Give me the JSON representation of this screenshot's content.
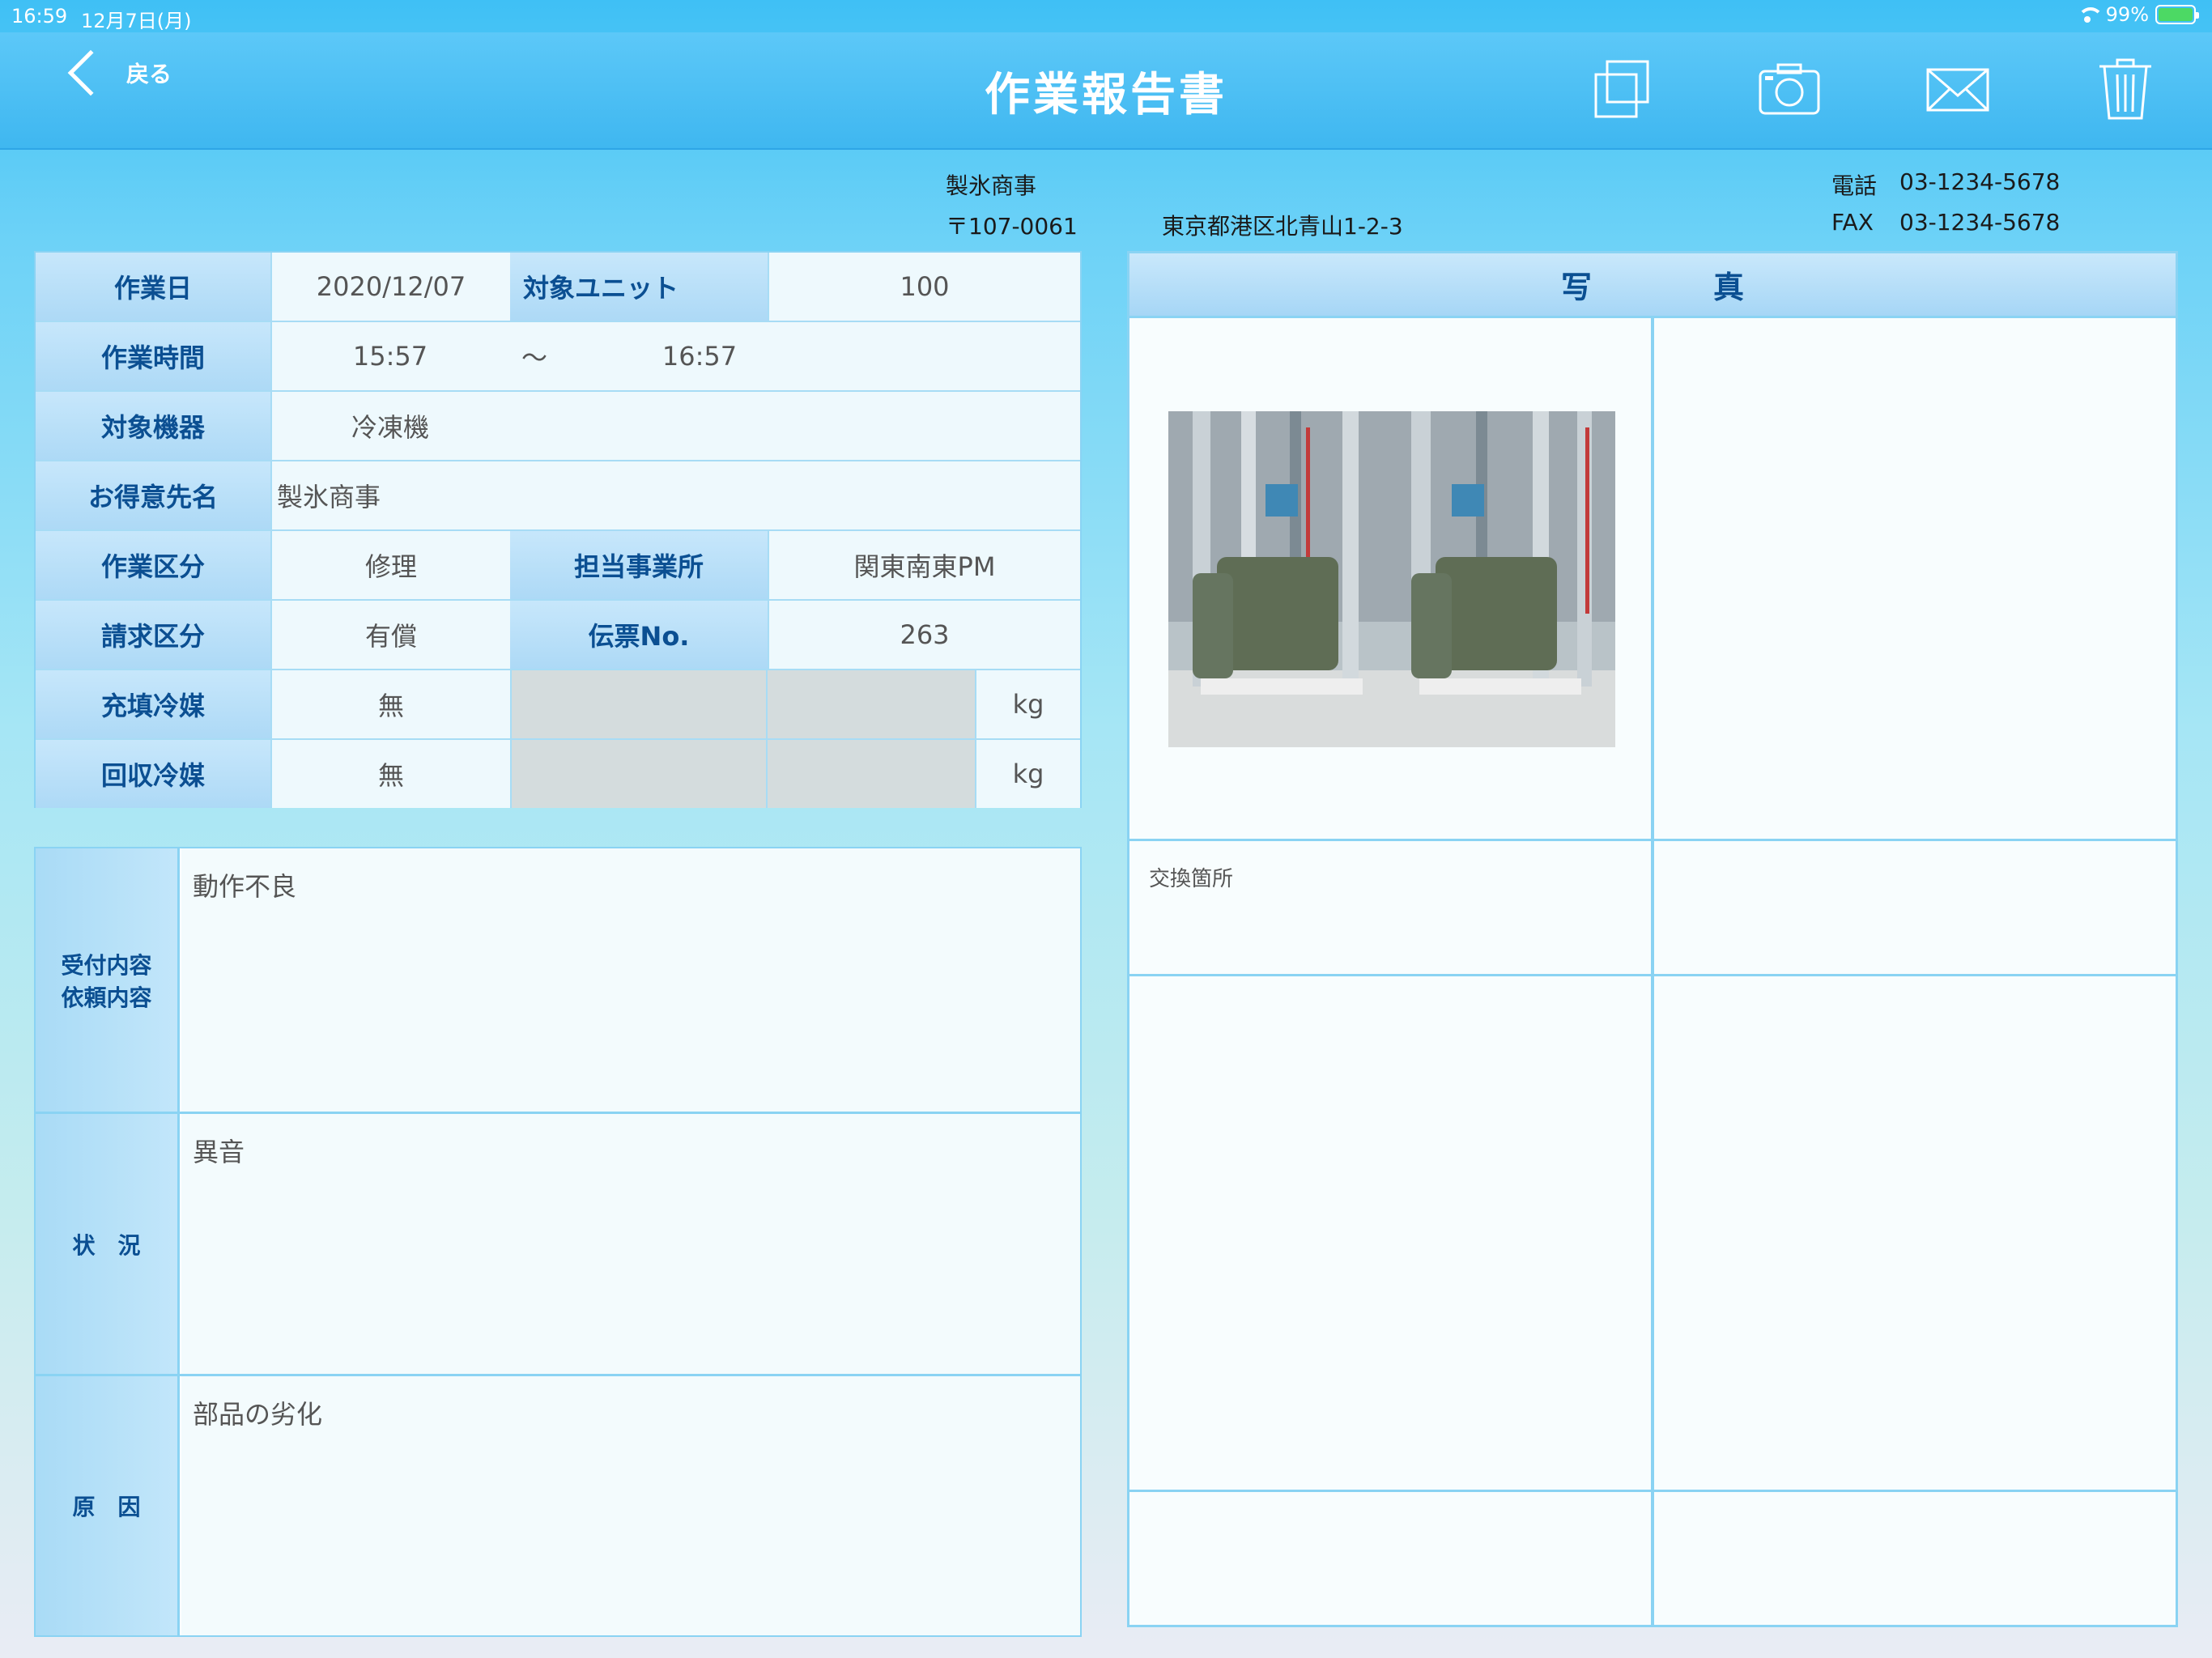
{
  "status": {
    "time": "16:59",
    "date": "12月7日(月)",
    "battery": "99%"
  },
  "nav": {
    "back_label": "戻る",
    "title": "作業報告書"
  },
  "company": {
    "name": "製氷商事",
    "postal": "〒107-0061",
    "address": "東京都港区北青山1-2-3",
    "tel_label": "電話",
    "tel": "03-1234-5678",
    "fax_label": "FAX",
    "fax": "03-1234-5678"
  },
  "info": {
    "work_date_label": "作業日",
    "work_date": "2020/12/07",
    "unit_label": "対象ユニット",
    "unit": "100",
    "work_time_label": "作業時間",
    "start_time": "15:57",
    "tilde": "〜",
    "end_time": "16:57",
    "equipment_label": "対象機器",
    "equipment": "冷凍機",
    "customer_label": "お得意先名",
    "customer": "製氷商事",
    "work_type_label": "作業区分",
    "work_type": "修理",
    "office_label": "担当事業所",
    "office": "関東南東PM",
    "billing_label": "請求区分",
    "billing": "有償",
    "slip_label": "伝票No.",
    "slip": "263",
    "refill_label": "充填冷媒",
    "refill": "無",
    "recover_label": "回収冷媒",
    "recover": "無",
    "kg": "kg"
  },
  "notes": {
    "request_label_1": "受付内容",
    "request_label_2": "依頼内容",
    "request": "動作不良",
    "status_label": "状　況",
    "status": "異音",
    "cause_label": "原　因",
    "cause": "部品の劣化"
  },
  "photo": {
    "header": "写真",
    "exchange_label": "交換箇所"
  },
  "colors": {
    "nav": "#3fb7f0",
    "label": "#0b4f92",
    "border": "#8ad3f3"
  }
}
